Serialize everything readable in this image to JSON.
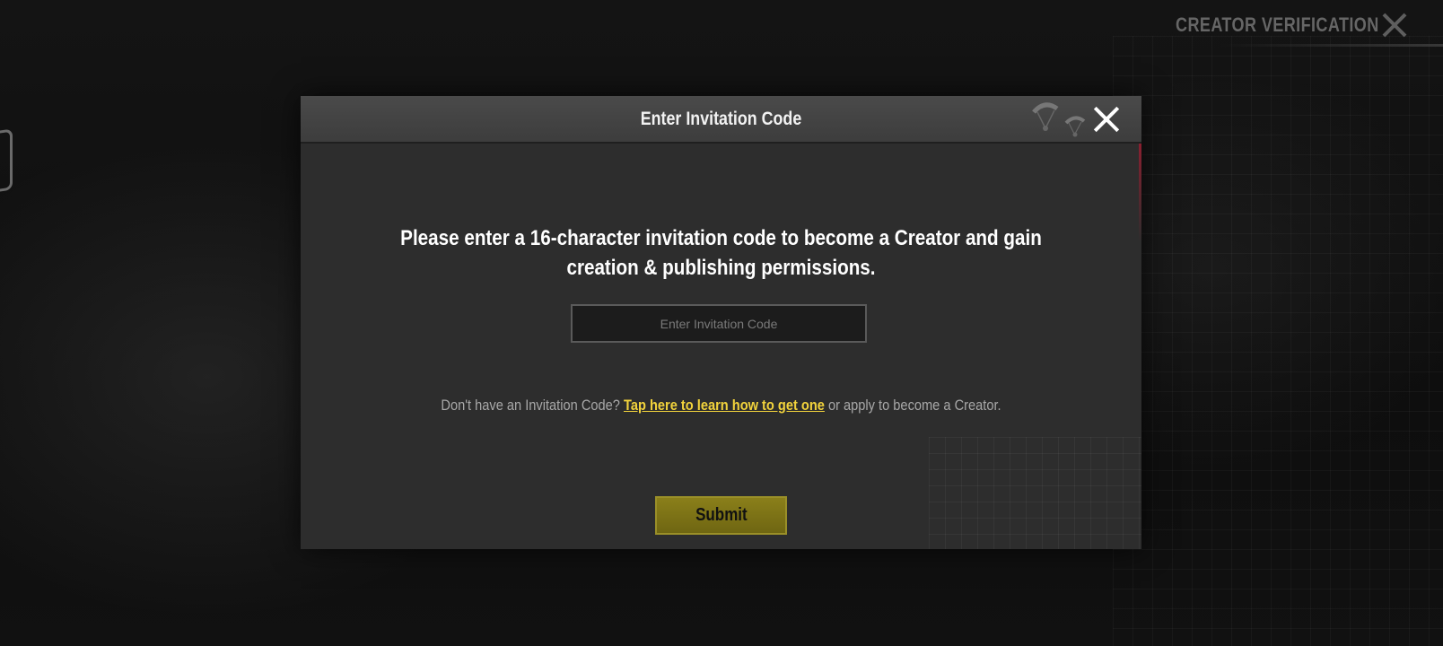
{
  "page": {
    "title": "CREATOR VERIFICATION"
  },
  "dialog": {
    "title": "Enter Invitation Code",
    "instruction": "Please enter a 16-character invitation code to become a Creator and gain creation & publishing permissions.",
    "input": {
      "placeholder": "Enter Invitation Code",
      "value": ""
    },
    "help": {
      "prefix": "Don't have an Invitation Code?",
      "link": "Tap here to learn how to get one",
      "suffix": "or apply to become a Creator."
    },
    "submit_label": "Submit"
  },
  "colors": {
    "accent_link": "#f2d33c",
    "submit_button": "#7d7417",
    "dialog_bg": "#2d2d2d",
    "header_bg": "#444444"
  },
  "icons": {
    "top_close": "close-icon",
    "dialog_close": "close-icon",
    "decoration": "parachute-icon"
  }
}
